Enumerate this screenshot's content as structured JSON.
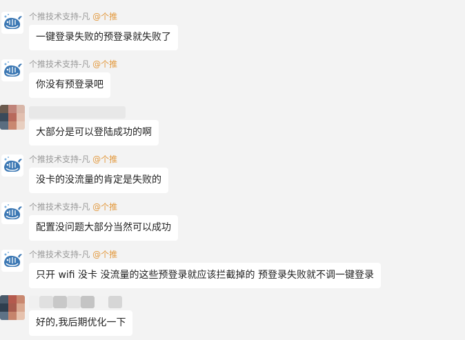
{
  "sender_name": "个推技术支持-凡",
  "mention": "@个推",
  "messages": [
    {
      "type": "bot",
      "text": "一键登录失败的预登录就失败了"
    },
    {
      "type": "bot",
      "text": "你没有预登录吧"
    },
    {
      "type": "user",
      "text": "大部分是可以登陆成功的啊"
    },
    {
      "type": "bot",
      "text": "没卡的没流量的肯定是失败的"
    },
    {
      "type": "bot",
      "text": "配置没问题大部分当然可以成功"
    },
    {
      "type": "bot",
      "text": "只开 wifi 没卡 没流量的这些预登录就应该拦截掉的 预登录失败就不调一键登录"
    },
    {
      "type": "user",
      "text": "好的,我后期优化一下"
    }
  ],
  "colors": {
    "background": "#f3f3f3",
    "bubble": "#ffffff",
    "mention": "#e39a3f",
    "sender": "#9a9a9a"
  },
  "icons": {
    "bot_avatar": "whale-icon",
    "user_avatar": "pixelated-photo-icon"
  }
}
